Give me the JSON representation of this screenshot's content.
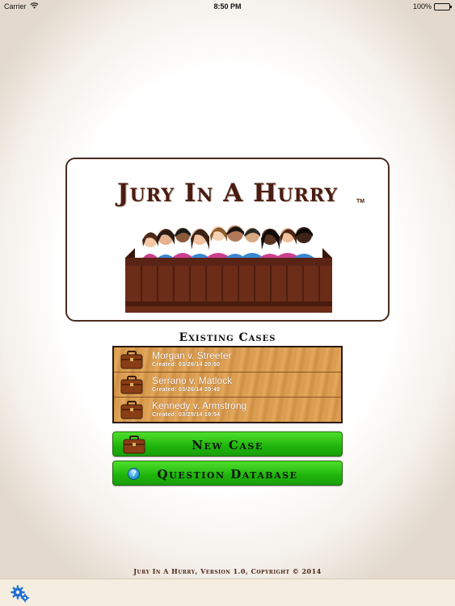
{
  "status_bar": {
    "carrier": "Carrier",
    "time": "8:50 PM",
    "battery": "100%"
  },
  "logo": {
    "title": "Jury In A Hurry",
    "trademark": "TM"
  },
  "cases": {
    "heading": "Existing Cases",
    "items": [
      {
        "name": "Morgan v. Streeter",
        "created": "Created: 03/26/14 20:50"
      },
      {
        "name": "Serrano v. Matlock",
        "created": "Created: 03/26/14 20:49"
      },
      {
        "name": "Kennedy v. Armstrong",
        "created": "Created: 03/25/14 19:54"
      }
    ]
  },
  "buttons": {
    "new_case": "New Case",
    "question_database": "Question Database"
  },
  "footer": "Jury In A Hurry, Version 1.0, Copyright © 2014",
  "icons": {
    "case": "briefcase-icon",
    "question": "question-icon",
    "settings": "gear-icon"
  },
  "colors": {
    "brand_brown": "#4b1d12",
    "button_green": "#1fb40c",
    "wood": "#d9994d"
  }
}
